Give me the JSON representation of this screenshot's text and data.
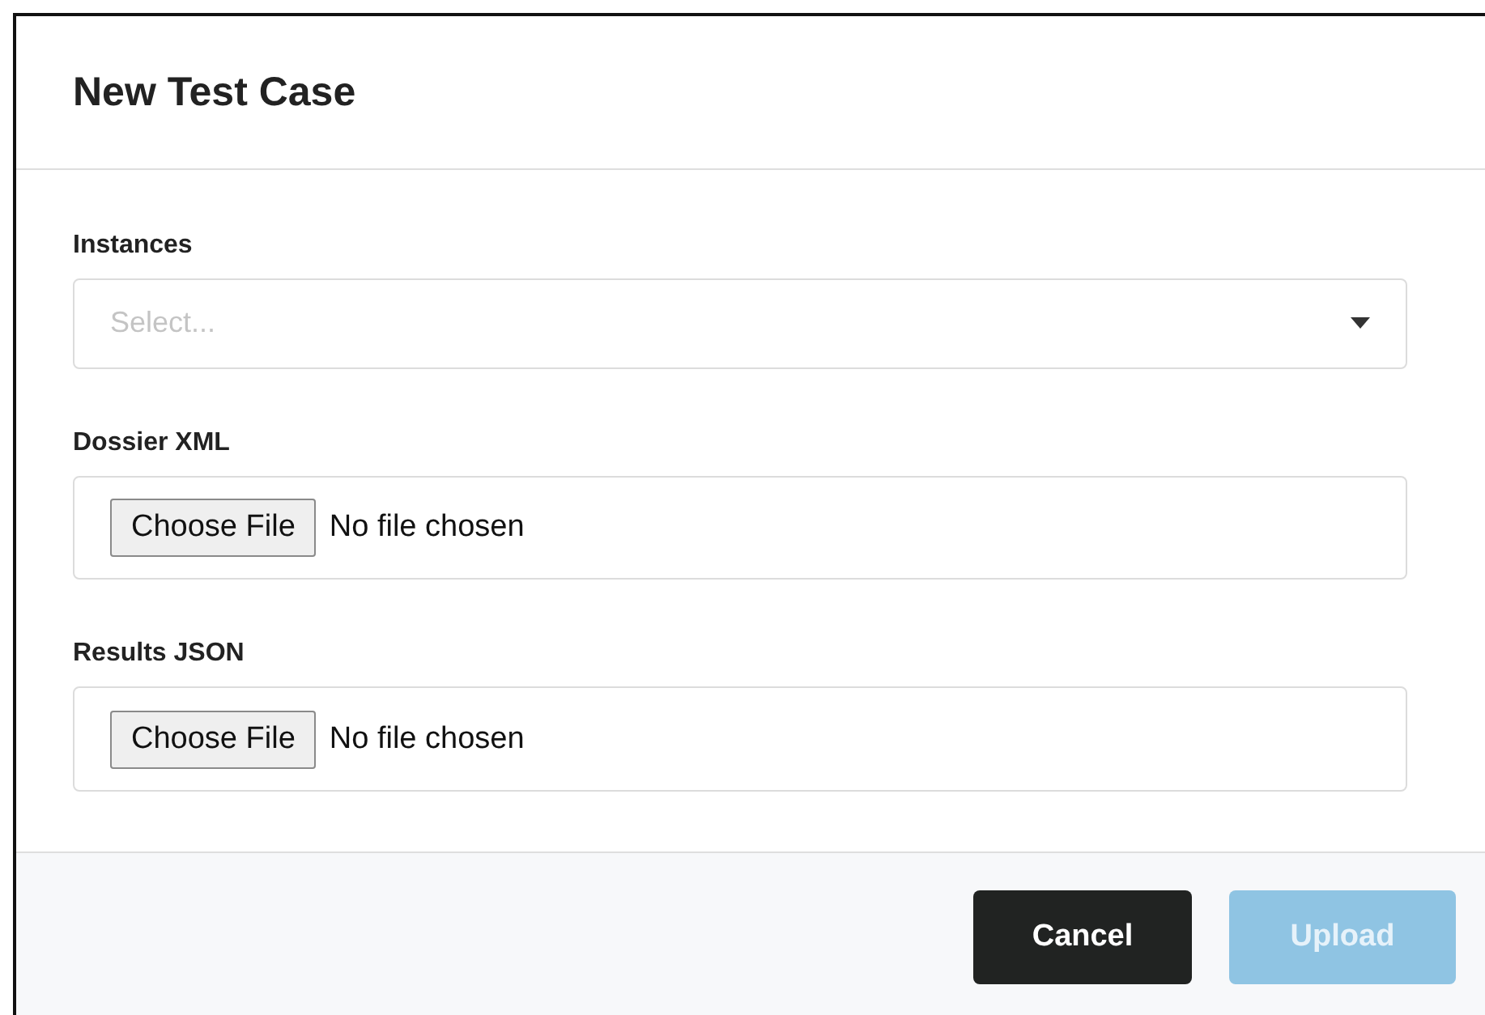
{
  "dialog": {
    "title": "New Test Case"
  },
  "fields": [
    {
      "kind": "select",
      "label": "Instances",
      "placeholder": "Select..."
    },
    {
      "kind": "file",
      "label": "Dossier XML",
      "button": "Choose File",
      "status": "No file chosen"
    },
    {
      "kind": "file",
      "label": "Results JSON",
      "button": "Choose File",
      "status": "No file chosen"
    }
  ],
  "buttons": [
    {
      "label": "Cancel",
      "kind": "secondary",
      "disabled": false
    },
    {
      "label": "Upload",
      "kind": "primary",
      "disabled": true
    }
  ]
}
